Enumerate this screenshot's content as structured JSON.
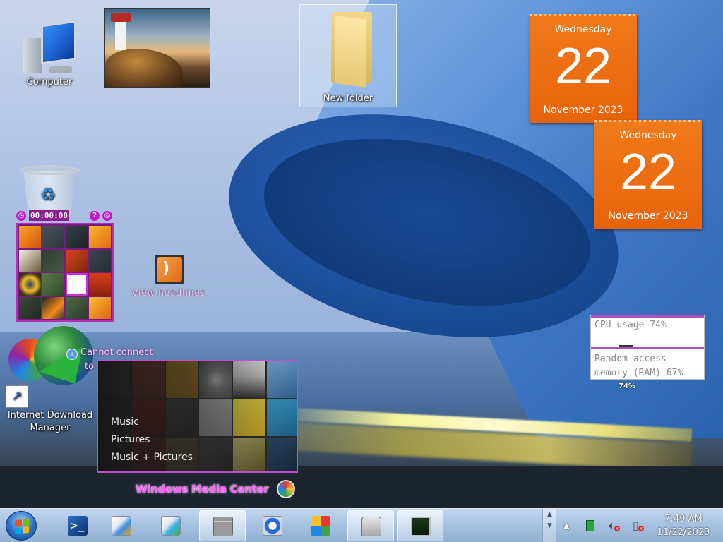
{
  "desktop": {
    "icons": {
      "computer": "Computer",
      "new_folder": "New folder",
      "idm_line1": "Internet Download",
      "idm_line2": "Manager"
    }
  },
  "puzzle_gadget": {
    "timer": "00:00:00",
    "help_glyph": "?",
    "pic_glyph": "◎"
  },
  "rss_gadget": {
    "label": "View headlines"
  },
  "weather_gadget": {
    "line1": "Cannot connect",
    "line2": "to service"
  },
  "media_center": {
    "menu": [
      "Music",
      "Pictures",
      "Music + Pictures"
    ],
    "title": "Windows Media Center"
  },
  "calendars": [
    {
      "weekday": "Wednesday",
      "day": "22",
      "month_year": "November 2023"
    },
    {
      "weekday": "Wednesday",
      "day": "22",
      "month_year": "November 2023"
    }
  ],
  "cpu_meter": {
    "cpu_label": "CPU usage 74%",
    "ram_line1": "Random access",
    "ram_line2": "memory (RAM) 67%",
    "cpu_value": "74%"
  },
  "taskbar": {
    "buttons": [
      {
        "icon": "powershell-icon"
      },
      {
        "icon": "programs-icon"
      },
      {
        "icon": "programs-icon-2"
      },
      {
        "icon": "firewall-icon"
      },
      {
        "icon": "info-monitor-icon"
      },
      {
        "icon": "windows-logo-icon"
      },
      {
        "icon": "scanner-icon"
      },
      {
        "icon": "performance-monitor-icon"
      }
    ],
    "tray_up": "▲",
    "clock_time": "7:49 AM",
    "clock_date": "11/22/2023"
  },
  "colors": {
    "calendar_orange": "#e8630a",
    "gadget_accent": "#c318c8",
    "taskbar": "#aac3e1"
  }
}
